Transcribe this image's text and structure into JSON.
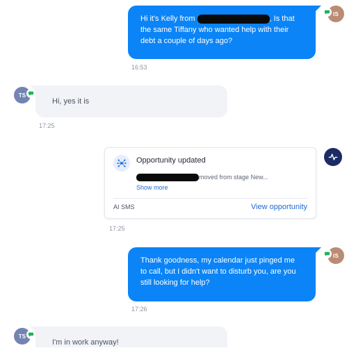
{
  "messages": [
    {
      "avatar": "IS",
      "text_before": "Hi it's Kelly from",
      "text_after": ", Is that the same Tiffany who wanted help with their debt a couple of days ago?",
      "time": "16:53"
    },
    {
      "avatar": "TS",
      "text": "Hi, yes it is",
      "time": "17:25"
    },
    {
      "avatar": "IS",
      "text": "Thank goodness, my calendar just pinged me to call, but I didn't want to disturb you, are you still looking for help?",
      "time": "17:26"
    },
    {
      "avatar": "TS",
      "text": "I'm in work anyway!"
    }
  ],
  "activity": {
    "title": "Opportunity updated",
    "description": "moved from stage New...",
    "show_more": "Show more",
    "source": "AI SMS",
    "link": "View opportunity",
    "time": "17:25"
  },
  "icons": {
    "channel_badge": "sms-chat-icon",
    "activity_avatar": "activity-pulse-icon",
    "card_icon": "opportunity-hub-icon"
  },
  "colors": {
    "outgoing_bubble": "#0b84f7",
    "incoming_bubble": "#f1f3f7",
    "link": "#1f6ad7",
    "sms_badge": "#1fb35a"
  }
}
